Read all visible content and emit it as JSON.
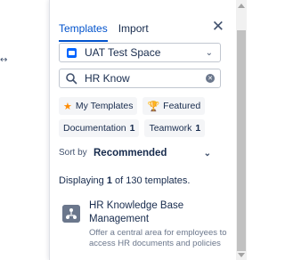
{
  "background": {
    "expand_icon": "↔",
    "expand_icon_name": "double-arrow-icon"
  },
  "tabs": [
    {
      "label": "Templates",
      "active": true
    },
    {
      "label": "Import",
      "active": false
    }
  ],
  "close_icon": "✕",
  "space_select": {
    "value": "UAT Test Space",
    "chevron": "⌄"
  },
  "search": {
    "value": "HR Know",
    "placeholder": "",
    "clear_glyph": "✕"
  },
  "filters": {
    "my_templates": {
      "label": "My Templates",
      "glyph": "★",
      "color": "#ff8b00"
    },
    "featured": {
      "label": "Featured",
      "glyph": "🏆",
      "color": "#ff991f"
    },
    "documentation": {
      "label": "Documentation",
      "count": "1"
    },
    "teamwork": {
      "label": "Teamwork",
      "count": "1"
    }
  },
  "sort": {
    "label": "Sort by",
    "value": "Recommended",
    "chevron": "⌄"
  },
  "results_info": {
    "prefix": "Displaying",
    "shown": "1",
    "middle": "of 130 templates."
  },
  "results": [
    {
      "title": "HR Knowledge Base Management",
      "description": "Offer a central area for employees to access HR documents and policies"
    }
  ],
  "colors": {
    "accent": "#0052cc",
    "space_icon": "#0065ff",
    "template_icon": "#6b778c"
  }
}
